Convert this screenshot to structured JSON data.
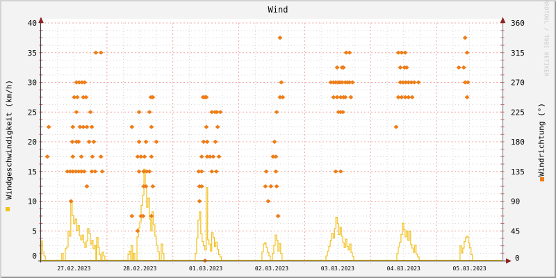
{
  "title": "Wind",
  "watermark": "RRDTOOL / TOBI OETIKER",
  "y_left": {
    "label": "Windgeschwindigkeit (km/h)",
    "min": 0,
    "max": 40,
    "ticks": [
      0,
      5,
      10,
      15,
      20,
      25,
      30,
      35,
      40
    ]
  },
  "y_right": {
    "label": "Windrichtung (°)",
    "min": 0,
    "max": 360,
    "ticks": [
      0,
      45,
      90,
      135,
      180,
      225,
      270,
      315,
      360
    ]
  },
  "x_axis": {
    "labels": [
      "27.02.2023",
      "28.02.2023",
      "01.03.2023",
      "02.03.2023",
      "03.03.2023",
      "04.03.2023",
      "05.03.2023"
    ],
    "hours_span": 168
  },
  "colors": {
    "speed": "#f2c01c",
    "direction": "#ee7d18",
    "grid_major": "#f2a4a4",
    "grid_minor": "#d6d6d6",
    "axis_tick_red": "#cc5c5c",
    "axis": "#3f3f3f",
    "axis_right": "#8d8d8d",
    "arrow": "#8e2222",
    "canvas": "#ffffff",
    "background": "#f3f3f3"
  },
  "chart_data": {
    "type": "line",
    "x_unit": "hours since 27.02.2023 00:00",
    "grid": "on",
    "series": [
      {
        "name": "Windgeschwindigkeit",
        "type": "step-line",
        "axis": "left",
        "unit": "km/h",
        "color": "#f2c01c",
        "points": [
          [
            0.3,
            3.3
          ],
          [
            0.8,
            1.5
          ],
          [
            1.3,
            0.8
          ],
          [
            7.8,
            1.2
          ],
          [
            9.1,
            2.0
          ],
          [
            9.6,
            2.3
          ],
          [
            10.1,
            5.0
          ],
          [
            10.6,
            4.1
          ],
          [
            11.1,
            9.8
          ],
          [
            11.6,
            7.6
          ],
          [
            12.1,
            6.2
          ],
          [
            12.7,
            7.0
          ],
          [
            13.2,
            5.1
          ],
          [
            13.7,
            5.9
          ],
          [
            14.2,
            4.2
          ],
          [
            14.7,
            3.5
          ],
          [
            15.2,
            4.3
          ],
          [
            15.7,
            3.0
          ],
          [
            16.2,
            2.2
          ],
          [
            16.7,
            3.3
          ],
          [
            17.2,
            5.4
          ],
          [
            17.7,
            4.6
          ],
          [
            18.2,
            2.8
          ],
          [
            18.7,
            3.4
          ],
          [
            19.2,
            2.0
          ],
          [
            19.7,
            2.5
          ],
          [
            20.5,
            3.9
          ],
          [
            21.0,
            2.2
          ],
          [
            21.5,
            1.0
          ],
          [
            22.5,
            1.4
          ],
          [
            23.0,
            0.8
          ],
          [
            31.9,
            1.0
          ],
          [
            32.4,
            1.6
          ],
          [
            33.1,
            2.5
          ],
          [
            33.9,
            1.2
          ],
          [
            35.2,
            4.0
          ],
          [
            35.7,
            5.5
          ],
          [
            36.2,
            6.5
          ],
          [
            36.7,
            9.3
          ],
          [
            37.2,
            11.0
          ],
          [
            37.7,
            15.4
          ],
          [
            38.2,
            12.5
          ],
          [
            38.7,
            9.0
          ],
          [
            39.2,
            10.5
          ],
          [
            39.7,
            7.0
          ],
          [
            40.2,
            5.0
          ],
          [
            40.7,
            8.2
          ],
          [
            41.2,
            6.0
          ],
          [
            41.7,
            4.1
          ],
          [
            42.3,
            2.6
          ],
          [
            42.8,
            1.5
          ],
          [
            44.0,
            2.8
          ],
          [
            44.5,
            1.2
          ],
          [
            56.4,
            1.2
          ],
          [
            56.9,
            3.8
          ],
          [
            57.4,
            6.8
          ],
          [
            57.9,
            8.2
          ],
          [
            58.4,
            4.5
          ],
          [
            58.9,
            3.2
          ],
          [
            59.4,
            2.5
          ],
          [
            59.9,
            1.8
          ],
          [
            60.4,
            12.3
          ],
          [
            60.9,
            3.5
          ],
          [
            61.4,
            2.8
          ],
          [
            61.9,
            1.6
          ],
          [
            62.4,
            4.7
          ],
          [
            62.9,
            3.9
          ],
          [
            63.4,
            2.4
          ],
          [
            63.9,
            3.1
          ],
          [
            64.4,
            1.9
          ],
          [
            64.9,
            1.0
          ],
          [
            65.4,
            0.6
          ],
          [
            80.7,
            1.5
          ],
          [
            81.2,
            2.8
          ],
          [
            81.7,
            3.0
          ],
          [
            82.2,
            2.2
          ],
          [
            82.7,
            1.4
          ],
          [
            83.2,
            0.8
          ],
          [
            84.5,
            1.2
          ],
          [
            85.0,
            2.6
          ],
          [
            85.5,
            4.3
          ],
          [
            86.0,
            3.4
          ],
          [
            86.5,
            1.6
          ],
          [
            87.0,
            2.9
          ],
          [
            87.5,
            1.2
          ],
          [
            104.0,
            0.8
          ],
          [
            104.5,
            1.6
          ],
          [
            105.0,
            2.4
          ],
          [
            105.6,
            3.4
          ],
          [
            106.1,
            4.6
          ],
          [
            106.6,
            3.8
          ],
          [
            107.1,
            5.4
          ],
          [
            107.6,
            7.3
          ],
          [
            108.1,
            6.2
          ],
          [
            108.6,
            4.4
          ],
          [
            109.1,
            5.6
          ],
          [
            109.6,
            4.1
          ],
          [
            110.1,
            3.0
          ],
          [
            110.6,
            2.2
          ],
          [
            111.1,
            3.6
          ],
          [
            111.6,
            2.4
          ],
          [
            112.1,
            1.8
          ],
          [
            112.6,
            2.8
          ],
          [
            113.1,
            1.4
          ],
          [
            113.6,
            0.7
          ],
          [
            129.8,
            1.2
          ],
          [
            130.3,
            2.3
          ],
          [
            130.8,
            3.1
          ],
          [
            131.3,
            4.4
          ],
          [
            131.8,
            6.3
          ],
          [
            132.3,
            5.2
          ],
          [
            132.8,
            4.0
          ],
          [
            133.3,
            5.0
          ],
          [
            133.8,
            3.4
          ],
          [
            134.3,
            4.9
          ],
          [
            134.8,
            2.7
          ],
          [
            135.3,
            2.1
          ],
          [
            135.8,
            1.4
          ],
          [
            136.3,
            2.6
          ],
          [
            136.8,
            1.1
          ],
          [
            137.4,
            0.6
          ],
          [
            152.8,
            2.5
          ],
          [
            153.3,
            1.3
          ],
          [
            153.8,
            2.1
          ],
          [
            154.3,
            3.2
          ],
          [
            154.8,
            3.9
          ],
          [
            155.3,
            4.1
          ],
          [
            155.8,
            3.0
          ],
          [
            156.3,
            2.2
          ],
          [
            156.8,
            1.0
          ]
        ]
      },
      {
        "name": "Windrichtung",
        "type": "scatter",
        "axis": "right",
        "unit": "°",
        "color": "#ee7d18",
        "points": [
          [
            20.0,
            315
          ],
          [
            21.8,
            315
          ],
          [
            12.9,
            270
          ],
          [
            13.9,
            270
          ],
          [
            14.9,
            270
          ],
          [
            15.9,
            270
          ],
          [
            12.1,
            247.5
          ],
          [
            13.2,
            247.5
          ],
          [
            15.4,
            247.5
          ],
          [
            16.4,
            247.5
          ],
          [
            12.9,
            225
          ],
          [
            18.0,
            225
          ],
          [
            2.8,
            202.5
          ],
          [
            11.6,
            202.5
          ],
          [
            14.2,
            202.5
          ],
          [
            15.4,
            202.5
          ],
          [
            16.7,
            202.5
          ],
          [
            18.5,
            202.5
          ],
          [
            11.4,
            180
          ],
          [
            12.9,
            180
          ],
          [
            13.7,
            180
          ],
          [
            17.5,
            180
          ],
          [
            19.2,
            180
          ],
          [
            2.3,
            157.5
          ],
          [
            11.6,
            157.5
          ],
          [
            14.7,
            157.5
          ],
          [
            18.7,
            157.5
          ],
          [
            21.8,
            157.5
          ],
          [
            9.6,
            135
          ],
          [
            10.6,
            135
          ],
          [
            11.6,
            135
          ],
          [
            12.7,
            135
          ],
          [
            13.7,
            135
          ],
          [
            14.7,
            135
          ],
          [
            15.7,
            135
          ],
          [
            18.5,
            135
          ],
          [
            19.7,
            135
          ],
          [
            22.3,
            135
          ],
          [
            16.7,
            112.5
          ],
          [
            10.9,
            90
          ],
          [
            40.0,
            247.5
          ],
          [
            40.7,
            247.5
          ],
          [
            35.7,
            225
          ],
          [
            39.5,
            225
          ],
          [
            33.1,
            202.5
          ],
          [
            40.2,
            202.5
          ],
          [
            35.7,
            180
          ],
          [
            38.2,
            180
          ],
          [
            42.0,
            180
          ],
          [
            35.2,
            157.5
          ],
          [
            36.4,
            157.5
          ],
          [
            37.7,
            157.5
          ],
          [
            40.2,
            157.5
          ],
          [
            35.7,
            135
          ],
          [
            37.4,
            135
          ],
          [
            38.5,
            135
          ],
          [
            39.5,
            135
          ],
          [
            37.4,
            112.5
          ],
          [
            38.2,
            112.5
          ],
          [
            40.7,
            112.5
          ],
          [
            33.1,
            67.5
          ],
          [
            36.4,
            67.5
          ],
          [
            37.2,
            67.5
          ],
          [
            40.2,
            67.5
          ],
          [
            35.2,
            45
          ],
          [
            59.0,
            247.5
          ],
          [
            59.7,
            247.5
          ],
          [
            60.2,
            247.5
          ],
          [
            62.2,
            225
          ],
          [
            63.3,
            225
          ],
          [
            64.0,
            225
          ],
          [
            65.3,
            225
          ],
          [
            60.2,
            202.5
          ],
          [
            64.3,
            202.5
          ],
          [
            59.2,
            180
          ],
          [
            60.5,
            180
          ],
          [
            63.5,
            180
          ],
          [
            58.5,
            157.5
          ],
          [
            60.5,
            157.5
          ],
          [
            61.5,
            157.5
          ],
          [
            62.7,
            157.5
          ],
          [
            64.8,
            157.5
          ],
          [
            57.4,
            135
          ],
          [
            58.5,
            135
          ],
          [
            62.2,
            135
          ],
          [
            63.8,
            135
          ],
          [
            57.7,
            112.5
          ],
          [
            58.5,
            112.5
          ],
          [
            57.7,
            90
          ],
          [
            59.7,
            0
          ],
          [
            87.0,
            337.5
          ],
          [
            87.5,
            270
          ],
          [
            87.0,
            247.5
          ],
          [
            88.0,
            247.5
          ],
          [
            85.8,
            225
          ],
          [
            85.0,
            180
          ],
          [
            84.5,
            157.5
          ],
          [
            85.5,
            157.5
          ],
          [
            82.0,
            135
          ],
          [
            85.5,
            135
          ],
          [
            81.7,
            112.5
          ],
          [
            83.7,
            112.5
          ],
          [
            85.8,
            112.5
          ],
          [
            82.7,
            90
          ],
          [
            86.3,
            67.5
          ],
          [
            111.1,
            315
          ],
          [
            112.3,
            315
          ],
          [
            107.8,
            292.5
          ],
          [
            109.6,
            292.5
          ],
          [
            110.1,
            292.5
          ],
          [
            105.5,
            270
          ],
          [
            106.5,
            270
          ],
          [
            107.3,
            270
          ],
          [
            108.1,
            270
          ],
          [
            108.8,
            270
          ],
          [
            109.6,
            270
          ],
          [
            110.8,
            270
          ],
          [
            111.6,
            270
          ],
          [
            112.3,
            270
          ],
          [
            113.4,
            270
          ],
          [
            106.5,
            247.5
          ],
          [
            107.8,
            247.5
          ],
          [
            109.1,
            247.5
          ],
          [
            110.1,
            247.5
          ],
          [
            110.8,
            247.5
          ],
          [
            112.8,
            247.5
          ],
          [
            108.3,
            225
          ],
          [
            109.1,
            225
          ],
          [
            109.9,
            225
          ],
          [
            107.3,
            135
          ],
          [
            109.1,
            135
          ],
          [
            130.1,
            315
          ],
          [
            131.3,
            315
          ],
          [
            132.6,
            315
          ],
          [
            130.8,
            292.5
          ],
          [
            132.3,
            292.5
          ],
          [
            133.1,
            292.5
          ],
          [
            130.8,
            270
          ],
          [
            131.8,
            270
          ],
          [
            132.8,
            270
          ],
          [
            133.8,
            270
          ],
          [
            134.8,
            270
          ],
          [
            135.9,
            270
          ],
          [
            137.4,
            270
          ],
          [
            130.1,
            247.5
          ],
          [
            131.3,
            247.5
          ],
          [
            132.6,
            247.5
          ],
          [
            133.8,
            247.5
          ],
          [
            135.1,
            247.5
          ],
          [
            129.3,
            202.5
          ],
          [
            154.4,
            337.5
          ],
          [
            155.1,
            315
          ],
          [
            152.1,
            292.5
          ],
          [
            153.9,
            292.5
          ],
          [
            154.4,
            270
          ],
          [
            155.4,
            270
          ],
          [
            155.1,
            247.5
          ]
        ]
      }
    ]
  }
}
